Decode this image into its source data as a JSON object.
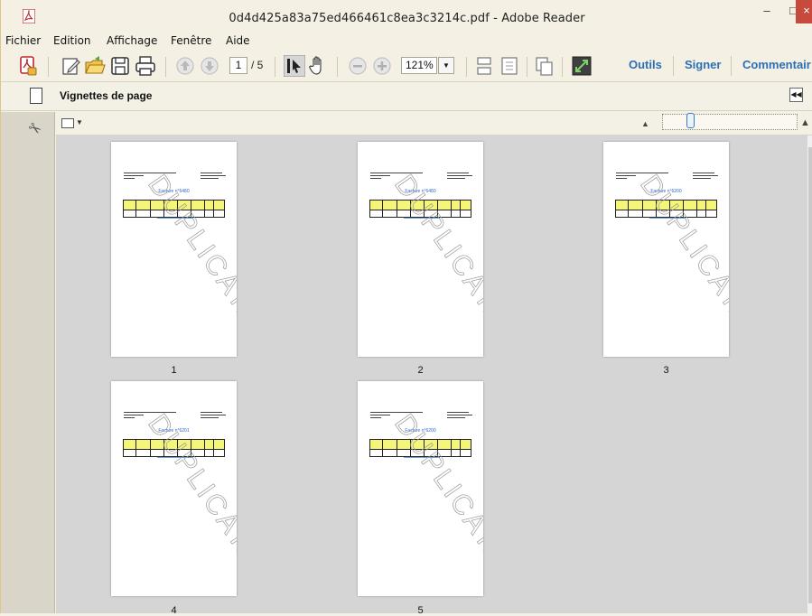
{
  "window": {
    "title": "0d4d425a83a75ed466461c8ea3c3214c.pdf - Adobe Reader",
    "controls": {
      "minimize": "‒",
      "maximize": "□",
      "close": "×"
    }
  },
  "menu": [
    "Fichier",
    "Edition",
    "Affichage",
    "Fenêtre",
    "Aide"
  ],
  "toolbar": {
    "current_page": "1",
    "total_pages": "/ 5",
    "zoom": "121%",
    "links": [
      "Outils",
      "Signer",
      "Commentair"
    ]
  },
  "panel": {
    "title": "Vignettes de page"
  },
  "thumbnails": [
    {
      "label": "1",
      "invoice": "Facture n°6480",
      "watermark": "DUPLICATA"
    },
    {
      "label": "2",
      "invoice": "Facture n°6480",
      "watermark": "DUPLICATA"
    },
    {
      "label": "3",
      "invoice": "Facture n°6200",
      "watermark": "DUPLICATA"
    },
    {
      "label": "4",
      "invoice": "Facture n°6201",
      "watermark": "DUPLICATA"
    },
    {
      "label": "5",
      "invoice": "Facture n°6200",
      "watermark": "DUPLICATA"
    }
  ],
  "colors": {
    "accent": "#2c6fb7",
    "close": "#c74a3c",
    "table_header": "#f5f57a",
    "pdf_icon": "#c1272d"
  }
}
